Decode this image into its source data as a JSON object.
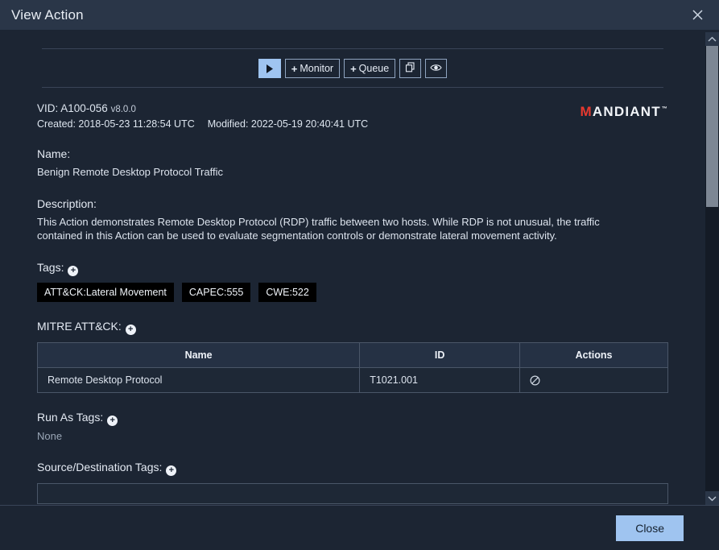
{
  "window": {
    "title": "View Action",
    "close_icon": "close-icon"
  },
  "toolbar": {
    "run_label": "▶",
    "monitor_label": "Monitor",
    "queue_label": "Queue",
    "plus": "+",
    "duplicate_icon": "copy-icon",
    "preview_icon": "eye-icon"
  },
  "meta": {
    "vid_label": "VID: A100-056",
    "version": "v8.0.0",
    "created": "Created: 2018-05-23 11:28:54 UTC",
    "modified": "Modified: 2022-05-19 20:40:41 UTC"
  },
  "brand": {
    "m": "M",
    "rest": "ANDIANT",
    "tm": "™"
  },
  "sections": {
    "name_label": "Name:",
    "name_value": "Benign Remote Desktop Protocol Traffic",
    "description_label": "Description:",
    "description_value": "This Action demonstrates Remote Desktop Protocol (RDP) traffic between two hosts. While RDP is not unusual, the traffic contained in this Action can be used to evaluate segmentation controls or demonstrate lateral movement activity.",
    "tags_label": "Tags:",
    "mitre_label": "MITRE ATT&CK:",
    "run_as_tags_label": "Run As Tags:",
    "run_as_tags_value": "None",
    "source_dest_tags_label": "Source/Destination Tags:",
    "add_icon": "+"
  },
  "tags": [
    "ATT&CK:Lateral Movement",
    "CAPEC:555",
    "CWE:522"
  ],
  "mitre_table": {
    "columns": [
      "Name",
      "ID",
      "Actions"
    ],
    "rows": [
      {
        "name": "Remote Desktop Protocol",
        "id": "T1021.001",
        "action_icon": "no-entry-icon"
      }
    ]
  },
  "footer": {
    "close_label": "Close"
  },
  "scrollbar": {
    "up_icon": "chevron-up-icon",
    "down_icon": "chevron-down-icon"
  },
  "colors": {
    "accent": "#9fc4f0",
    "brand_red": "#e8392f",
    "header_bg": "#2a3648",
    "body_bg": "#1c2533",
    "chip_bg": "#000000"
  }
}
